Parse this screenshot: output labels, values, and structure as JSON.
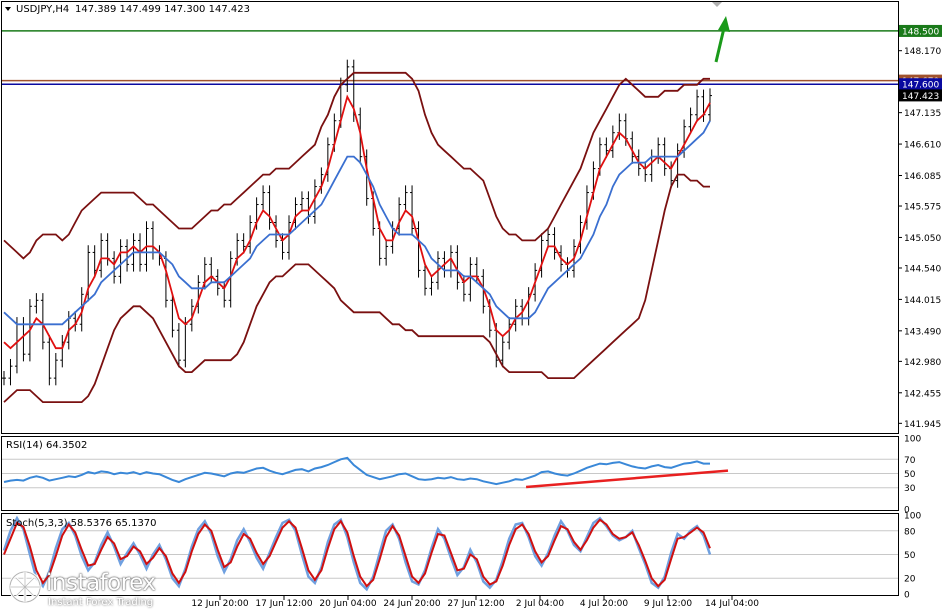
{
  "header": {
    "symbol_tf": "USDJPY,H4",
    "ohlc": "147.389 147.499 147.300 147.423"
  },
  "indicators": {
    "rsi_label": "RSI(14) 64.3502",
    "stoch_label": "Stoch(5,3,3) 58.5376 65.1370"
  },
  "watermark": {
    "brand": "instaforex",
    "tagline": "Instant Forex Trading"
  },
  "colors": {
    "grid": "#c8c8c8",
    "bollinger": "#7a1010",
    "ma_fast": "#e01010",
    "ma_slow": "#3a6fd0",
    "price": "#000000",
    "level_resist": "#a0522d",
    "level_blue": "#0a0aa0",
    "level_target": "#1a7a1a",
    "rsi_line": "#3a88d8",
    "trend_red": "#e82020",
    "arrow_green": "#1a9a1a"
  },
  "chart_data": [
    {
      "type": "line",
      "panel": "main",
      "ylim": [
        141.8,
        148.95
      ],
      "y_ticks": [
        "148.170",
        "147.135",
        "146.610",
        "146.085",
        "145.575",
        "145.050",
        "144.540",
        "144.015",
        "143.490",
        "142.980",
        "142.455",
        "141.945"
      ],
      "x_ticks": [
        "12 Jun 20:00",
        "17 Jun 12:00",
        "20 Jun 04:00",
        "24 Jun 20:00",
        "27 Jun 12:00",
        "2 Jul 04:00",
        "4 Jul 20:00",
        "9 Jul 12:00",
        "14 Jul 04:00"
      ],
      "levels": [
        {
          "price": 148.5,
          "label": "148.500",
          "style": "target"
        },
        {
          "price": 147.67,
          "label": "147.670",
          "style": "resist"
        },
        {
          "price": 147.61,
          "label": "147.600",
          "style": "blue"
        },
        {
          "price": 147.423,
          "label": "147.423",
          "style": "current"
        }
      ],
      "x_count": 120,
      "series": [
        {
          "role": "price",
          "values": [
            142.7,
            142.9,
            143.6,
            143.1,
            143.9,
            144.0,
            143.3,
            142.7,
            143.0,
            143.3,
            143.7,
            143.6,
            144.1,
            144.8,
            144.5,
            145.0,
            144.7,
            144.4,
            144.9,
            144.6,
            145.0,
            144.6,
            145.2,
            144.8,
            144.7,
            144.0,
            143.5,
            143.0,
            143.6,
            143.9,
            144.3,
            144.6,
            144.4,
            144.2,
            144.0,
            144.7,
            145.0,
            144.9,
            145.3,
            145.6,
            145.8,
            145.3,
            145.0,
            144.8,
            145.3,
            145.6,
            145.7,
            145.4,
            145.9,
            146.1,
            146.6,
            147.0,
            147.6,
            147.9,
            147.1,
            146.4,
            145.7,
            145.2,
            144.7,
            144.9,
            145.2,
            145.6,
            145.8,
            145.2,
            144.5,
            144.2,
            144.3,
            144.7,
            144.5,
            144.8,
            144.3,
            144.1,
            144.6,
            144.4,
            143.9,
            143.5,
            143.0,
            143.3,
            143.6,
            143.9,
            143.7,
            144.1,
            144.5,
            145.0,
            145.1,
            144.8,
            144.6,
            144.5,
            144.9,
            145.3,
            145.8,
            146.2,
            146.6,
            146.5,
            146.8,
            147.0,
            146.7,
            146.4,
            146.2,
            146.1,
            146.4,
            146.6,
            146.2,
            146.0,
            146.5,
            146.9,
            147.1,
            147.4,
            147.1,
            147.42
          ]
        },
        {
          "role": "ma_fast",
          "values": [
            143.3,
            143.2,
            143.3,
            143.4,
            143.5,
            143.7,
            143.6,
            143.4,
            143.2,
            143.2,
            143.5,
            143.6,
            143.8,
            144.2,
            144.4,
            144.7,
            144.7,
            144.6,
            144.8,
            144.8,
            144.9,
            144.8,
            144.9,
            144.9,
            144.8,
            144.5,
            144.1,
            143.7,
            143.6,
            143.7,
            144.0,
            144.3,
            144.4,
            144.3,
            144.2,
            144.4,
            144.7,
            144.8,
            145.0,
            145.3,
            145.5,
            145.4,
            145.2,
            145.0,
            145.1,
            145.4,
            145.5,
            145.5,
            145.7,
            145.9,
            146.2,
            146.6,
            147.0,
            147.4,
            147.2,
            146.8,
            146.2,
            145.7,
            145.2,
            145.0,
            145.0,
            145.3,
            145.5,
            145.4,
            145.0,
            144.6,
            144.4,
            144.5,
            144.6,
            144.7,
            144.5,
            144.3,
            144.4,
            144.4,
            144.2,
            143.9,
            143.5,
            143.4,
            143.5,
            143.7,
            143.8,
            144.0,
            144.3,
            144.6,
            144.9,
            144.9,
            144.7,
            144.6,
            144.7,
            145.0,
            145.4,
            145.8,
            146.2,
            146.4,
            146.6,
            146.8,
            146.7,
            146.5,
            146.3,
            146.2,
            146.3,
            146.4,
            146.3,
            146.2,
            146.4,
            146.6,
            146.8,
            147.0,
            147.1,
            147.3
          ]
        },
        {
          "role": "ma_slow",
          "values": [
            143.8,
            143.7,
            143.6,
            143.6,
            143.6,
            143.6,
            143.6,
            143.6,
            143.6,
            143.6,
            143.7,
            143.8,
            143.9,
            144.0,
            144.1,
            144.3,
            144.4,
            144.5,
            144.6,
            144.7,
            144.8,
            144.8,
            144.8,
            144.8,
            144.8,
            144.7,
            144.6,
            144.4,
            144.3,
            144.2,
            144.2,
            144.2,
            144.3,
            144.3,
            144.3,
            144.4,
            144.5,
            144.6,
            144.7,
            144.9,
            145.0,
            145.1,
            145.1,
            145.1,
            145.1,
            145.2,
            145.3,
            145.4,
            145.5,
            145.6,
            145.8,
            146.0,
            146.2,
            146.4,
            146.4,
            146.3,
            146.1,
            145.9,
            145.6,
            145.4,
            145.2,
            145.1,
            145.1,
            145.1,
            145.0,
            144.9,
            144.7,
            144.6,
            144.5,
            144.5,
            144.5,
            144.4,
            144.4,
            144.3,
            144.2,
            144.1,
            143.9,
            143.8,
            143.7,
            143.7,
            143.7,
            143.7,
            143.8,
            144.0,
            144.2,
            144.3,
            144.4,
            144.5,
            144.6,
            144.7,
            144.9,
            145.1,
            145.4,
            145.6,
            145.9,
            146.1,
            146.2,
            146.3,
            146.3,
            146.3,
            146.4,
            146.4,
            146.4,
            146.4,
            146.4,
            146.5,
            146.6,
            146.7,
            146.8,
            147.0
          ]
        },
        {
          "role": "bb_upper",
          "values": [
            145.0,
            144.9,
            144.8,
            144.7,
            144.8,
            145.0,
            145.1,
            145.1,
            145.1,
            145.0,
            145.1,
            145.3,
            145.5,
            145.6,
            145.7,
            145.8,
            145.8,
            145.8,
            145.8,
            145.8,
            145.8,
            145.7,
            145.6,
            145.6,
            145.5,
            145.4,
            145.3,
            145.2,
            145.2,
            145.2,
            145.3,
            145.4,
            145.5,
            145.5,
            145.6,
            145.6,
            145.7,
            145.8,
            145.9,
            146.0,
            146.1,
            146.1,
            146.2,
            146.2,
            146.2,
            146.3,
            146.4,
            146.5,
            146.6,
            146.9,
            147.1,
            147.4,
            147.6,
            147.7,
            147.8,
            147.8,
            147.8,
            147.8,
            147.8,
            147.8,
            147.8,
            147.8,
            147.8,
            147.7,
            147.5,
            147.1,
            146.8,
            146.6,
            146.5,
            146.4,
            146.3,
            146.2,
            146.2,
            146.1,
            146.0,
            145.7,
            145.4,
            145.2,
            145.1,
            145.1,
            145.0,
            145.0,
            145.0,
            145.1,
            145.2,
            145.4,
            145.6,
            145.8,
            146.0,
            146.2,
            146.5,
            146.8,
            147.0,
            147.2,
            147.4,
            147.6,
            147.7,
            147.6,
            147.5,
            147.4,
            147.4,
            147.4,
            147.5,
            147.5,
            147.5,
            147.6,
            147.6,
            147.6,
            147.7,
            147.7
          ]
        },
        {
          "role": "bb_lower",
          "values": [
            142.3,
            142.4,
            142.5,
            142.5,
            142.5,
            142.4,
            142.3,
            142.3,
            142.3,
            142.3,
            142.3,
            142.3,
            142.3,
            142.4,
            142.6,
            142.9,
            143.2,
            143.5,
            143.7,
            143.8,
            143.9,
            143.9,
            143.8,
            143.7,
            143.5,
            143.3,
            143.1,
            142.9,
            142.8,
            142.8,
            142.9,
            143.0,
            143.0,
            143.0,
            143.0,
            143.0,
            143.1,
            143.3,
            143.6,
            143.9,
            144.1,
            144.3,
            144.4,
            144.4,
            144.5,
            144.6,
            144.6,
            144.6,
            144.5,
            144.4,
            144.3,
            144.2,
            144.0,
            143.9,
            143.8,
            143.8,
            143.8,
            143.8,
            143.8,
            143.7,
            143.6,
            143.6,
            143.5,
            143.5,
            143.4,
            143.4,
            143.4,
            143.4,
            143.4,
            143.4,
            143.4,
            143.4,
            143.4,
            143.4,
            143.4,
            143.3,
            143.1,
            142.9,
            142.8,
            142.8,
            142.8,
            142.8,
            142.8,
            142.8,
            142.7,
            142.7,
            142.7,
            142.7,
            142.7,
            142.8,
            142.9,
            143.0,
            143.1,
            143.2,
            143.3,
            143.4,
            143.5,
            143.6,
            143.7,
            144.0,
            144.5,
            145.0,
            145.5,
            145.9,
            146.1,
            146.1,
            146.0,
            146.0,
            145.9,
            145.9
          ]
        }
      ]
    },
    {
      "type": "line",
      "panel": "rsi",
      "ylim": [
        0,
        100
      ],
      "y_ticks": [
        "100",
        "70",
        "50",
        "30",
        "0"
      ],
      "levels": [
        70,
        50,
        30
      ],
      "x_count": 120,
      "series": [
        {
          "role": "rsi",
          "values": [
            38,
            40,
            41,
            40,
            44,
            46,
            44,
            40,
            42,
            44,
            46,
            45,
            48,
            52,
            50,
            53,
            52,
            49,
            51,
            50,
            52,
            49,
            52,
            50,
            49,
            45,
            41,
            38,
            42,
            45,
            48,
            51,
            50,
            48,
            46,
            50,
            52,
            51,
            54,
            57,
            58,
            54,
            51,
            49,
            52,
            55,
            56,
            53,
            57,
            59,
            62,
            66,
            70,
            72,
            62,
            55,
            48,
            45,
            42,
            44,
            46,
            49,
            50,
            46,
            42,
            41,
            42,
            44,
            43,
            45,
            42,
            41,
            43,
            42,
            39,
            37,
            35,
            37,
            39,
            42,
            41,
            44,
            47,
            52,
            53,
            50,
            48,
            47,
            50,
            54,
            58,
            61,
            64,
            63,
            65,
            66,
            63,
            60,
            58,
            57,
            60,
            62,
            59,
            58,
            61,
            64,
            65,
            67,
            64,
            64
          ]
        }
      ],
      "trend_line": {
        "from": [
          88,
          31
        ],
        "to": [
          119,
          54
        ]
      }
    },
    {
      "type": "line",
      "panel": "stoch",
      "ylim": [
        0,
        100
      ],
      "y_ticks": [
        "100",
        "80",
        "50",
        "20",
        "0"
      ],
      "levels": [
        80,
        50,
        20
      ],
      "x_count": 120,
      "series": [
        {
          "role": "stoch_main",
          "values": [
            55,
            80,
            96,
            82,
            50,
            20,
            10,
            28,
            58,
            82,
            90,
            74,
            48,
            30,
            40,
            62,
            78,
            60,
            38,
            52,
            64,
            50,
            32,
            50,
            62,
            44,
            20,
            10,
            32,
            60,
            82,
            92,
            76,
            48,
            28,
            44,
            68,
            82,
            66,
            46,
            32,
            52,
            72,
            90,
            94,
            80,
            50,
            22,
            14,
            34,
            66,
            88,
            94,
            72,
            40,
            14,
            6,
            22,
            52,
            80,
            88,
            70,
            40,
            16,
            12,
            30,
            58,
            82,
            70,
            46,
            24,
            34,
            56,
            40,
            16,
            8,
            18,
            42,
            70,
            88,
            90,
            72,
            48,
            36,
            52,
            74,
            92,
            80,
            62,
            54,
            72,
            90,
            96,
            86,
            74,
            68,
            72,
            80,
            58,
            38,
            14,
            8,
            22,
            52,
            76,
            70,
            80,
            86,
            74,
            50
          ]
        },
        {
          "role": "stoch_signal",
          "values": [
            50,
            70,
            90,
            85,
            60,
            30,
            14,
            24,
            48,
            74,
            88,
            78,
            56,
            36,
            38,
            56,
            72,
            64,
            44,
            48,
            60,
            54,
            38,
            46,
            58,
            48,
            26,
            14,
            28,
            54,
            76,
            88,
            80,
            56,
            34,
            40,
            60,
            76,
            70,
            52,
            38,
            48,
            66,
            84,
            92,
            84,
            58,
            30,
            18,
            30,
            58,
            82,
            92,
            78,
            48,
            22,
            10,
            18,
            44,
            72,
            86,
            74,
            48,
            22,
            14,
            26,
            52,
            76,
            74,
            52,
            30,
            32,
            50,
            44,
            22,
            12,
            16,
            36,
            62,
            82,
            88,
            76,
            54,
            40,
            48,
            68,
            86,
            82,
            66,
            56,
            68,
            84,
            94,
            88,
            76,
            70,
            72,
            78,
            62,
            42,
            20,
            10,
            18,
            44,
            70,
            72,
            78,
            84,
            78,
            58
          ]
        }
      ]
    }
  ]
}
